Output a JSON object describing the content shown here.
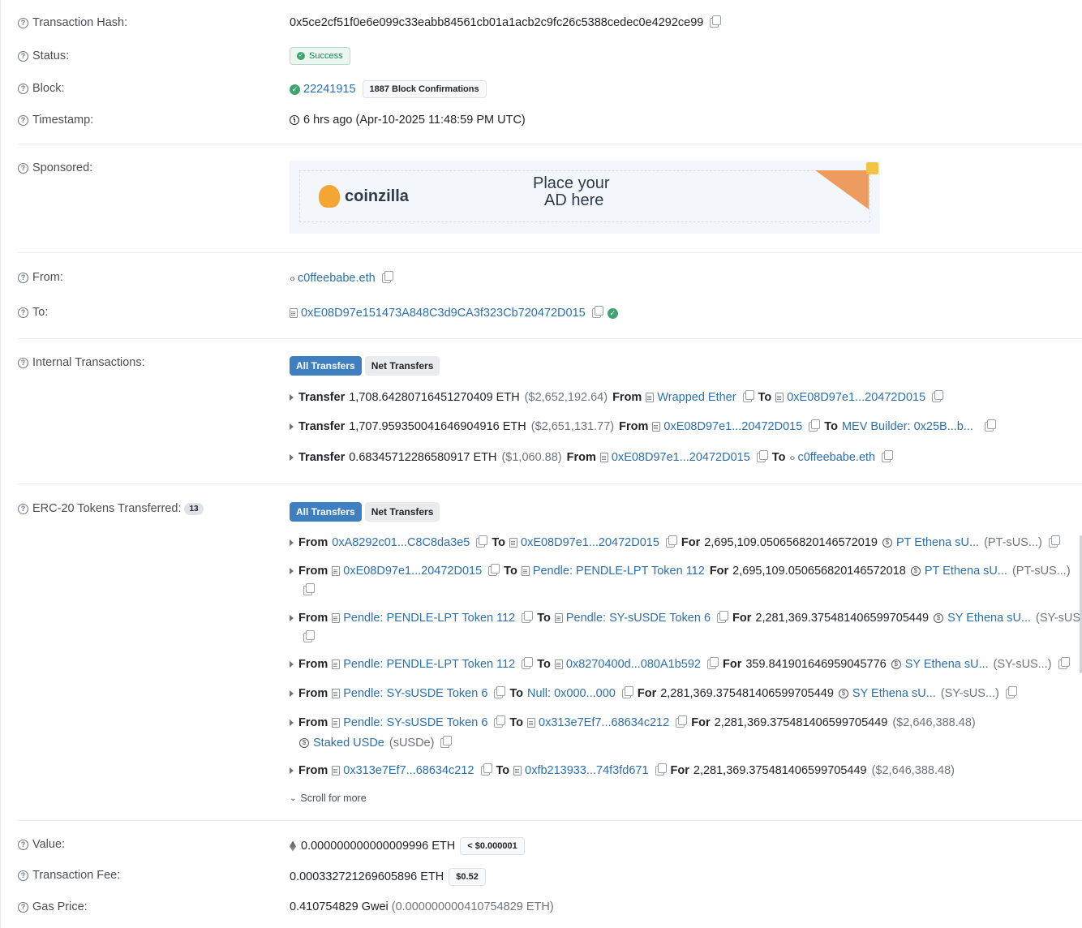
{
  "rows": {
    "tx_hash": {
      "label": "Transaction Hash:",
      "value": "0x5ce2cf51f0e6e099c33eabb84561cb01a1acb2c9fc26c5388cedec0e4292ce99"
    },
    "status": {
      "label": "Status:",
      "value": "Success"
    },
    "block": {
      "label": "Block:",
      "value": "22241915",
      "confirmations": "1887 Block Confirmations"
    },
    "timestamp": {
      "label": "Timestamp:",
      "value": "6 hrs ago (Apr-10-2025 11:48:59 PM UTC)"
    },
    "sponsored": {
      "label": "Sponsored:",
      "ad_brand": "coinzilla",
      "ad_line1": "Place your",
      "ad_line2": "AD here"
    },
    "from": {
      "label": "From:",
      "value": "c0ffeebabe.eth"
    },
    "to": {
      "label": "To:",
      "value": "0xE08D97e151473A848C3d9CA3f323Cb720472D015"
    },
    "internal": {
      "label": "Internal Transactions:",
      "tab_all": "All Transfers",
      "tab_net": "Net Transfers"
    },
    "erc20": {
      "label": "ERC-20 Tokens Transferred:",
      "count": "13",
      "tab_all": "All Transfers",
      "tab_net": "Net Transfers",
      "scroll_more": "Scroll for more"
    },
    "value": {
      "label": "Value:",
      "value": "0.000000000000009996 ETH",
      "usd": "< $0.000001"
    },
    "fee": {
      "label": "Transaction Fee:",
      "value": "0.000332721269605896 ETH",
      "usd": "$0.52"
    },
    "gas": {
      "label": "Gas Price:",
      "value": "0.410754829 Gwei",
      "eth": "(0.000000000410754829 ETH)"
    }
  },
  "words": {
    "transfer": "Transfer",
    "from": "From",
    "to": "To",
    "for": "For"
  },
  "internal_transfers": [
    {
      "amount": "1,708.64280716451270409 ETH",
      "usd": "($2,652,192.64)",
      "from": "Wrapped Ether",
      "to": "0xE08D97e1...20472D015"
    },
    {
      "amount": "1,707.959350041646904916 ETH",
      "usd": "($2,651,131.77)",
      "from": "0xE08D97e1...20472D015",
      "to": "MEV Builder: 0x25B...b..."
    },
    {
      "amount": "0.68345712286580917 ETH",
      "usd": "($1,060.88)",
      "from": "0xE08D97e1...20472D015",
      "to": "c0ffeebabe.eth"
    }
  ],
  "erc20_transfers": [
    {
      "from": "0xA8292c01...C8C8da3e5",
      "to": "0xE08D97e1...20472D015",
      "amount": "2,695,109.050656820146572019",
      "token": "PT Ethena sU...",
      "symbol": "(PT-sUS...)"
    },
    {
      "from": "0xE08D97e1...20472D015",
      "to": "Pendle: PENDLE-LPT Token 112",
      "amount": "2,695,109.050656820146572018",
      "token": "PT Ethena sU...",
      "symbol": "(PT-sUS...)"
    },
    {
      "from": "Pendle: PENDLE-LPT Token 112",
      "to": "Pendle: SY-sUSDE Token 6",
      "amount": "2,281,369.375481406599705449",
      "token": "SY Ethena sU...",
      "symbol": "(SY-sUS...)"
    },
    {
      "from": "Pendle: PENDLE-LPT Token 112",
      "to": "0x8270400d...080A1b592",
      "amount": "359.841901646959045776",
      "token": "SY Ethena sU...",
      "symbol": "(SY-sUS...)"
    },
    {
      "from": "Pendle: SY-sUSDE Token 6",
      "to": "Null: 0x000...000",
      "amount": "2,281,369.375481406599705449",
      "token": "SY Ethena sU...",
      "symbol": "(SY-sUS...)"
    },
    {
      "from": "Pendle: SY-sUSDE Token 6",
      "to": "0x313e7Ef7...68634c212",
      "amount": "2,281,369.375481406599705449",
      "usd": "($2,646,388.48)",
      "token": "Staked USDe",
      "symbol": "(sUSDe)"
    },
    {
      "from": "0x313e7Ef7...68634c212",
      "to": "0xfb213933...74f3fd671",
      "amount": "2,281,369.375481406599705449",
      "usd": "($2,646,388.48)"
    }
  ]
}
